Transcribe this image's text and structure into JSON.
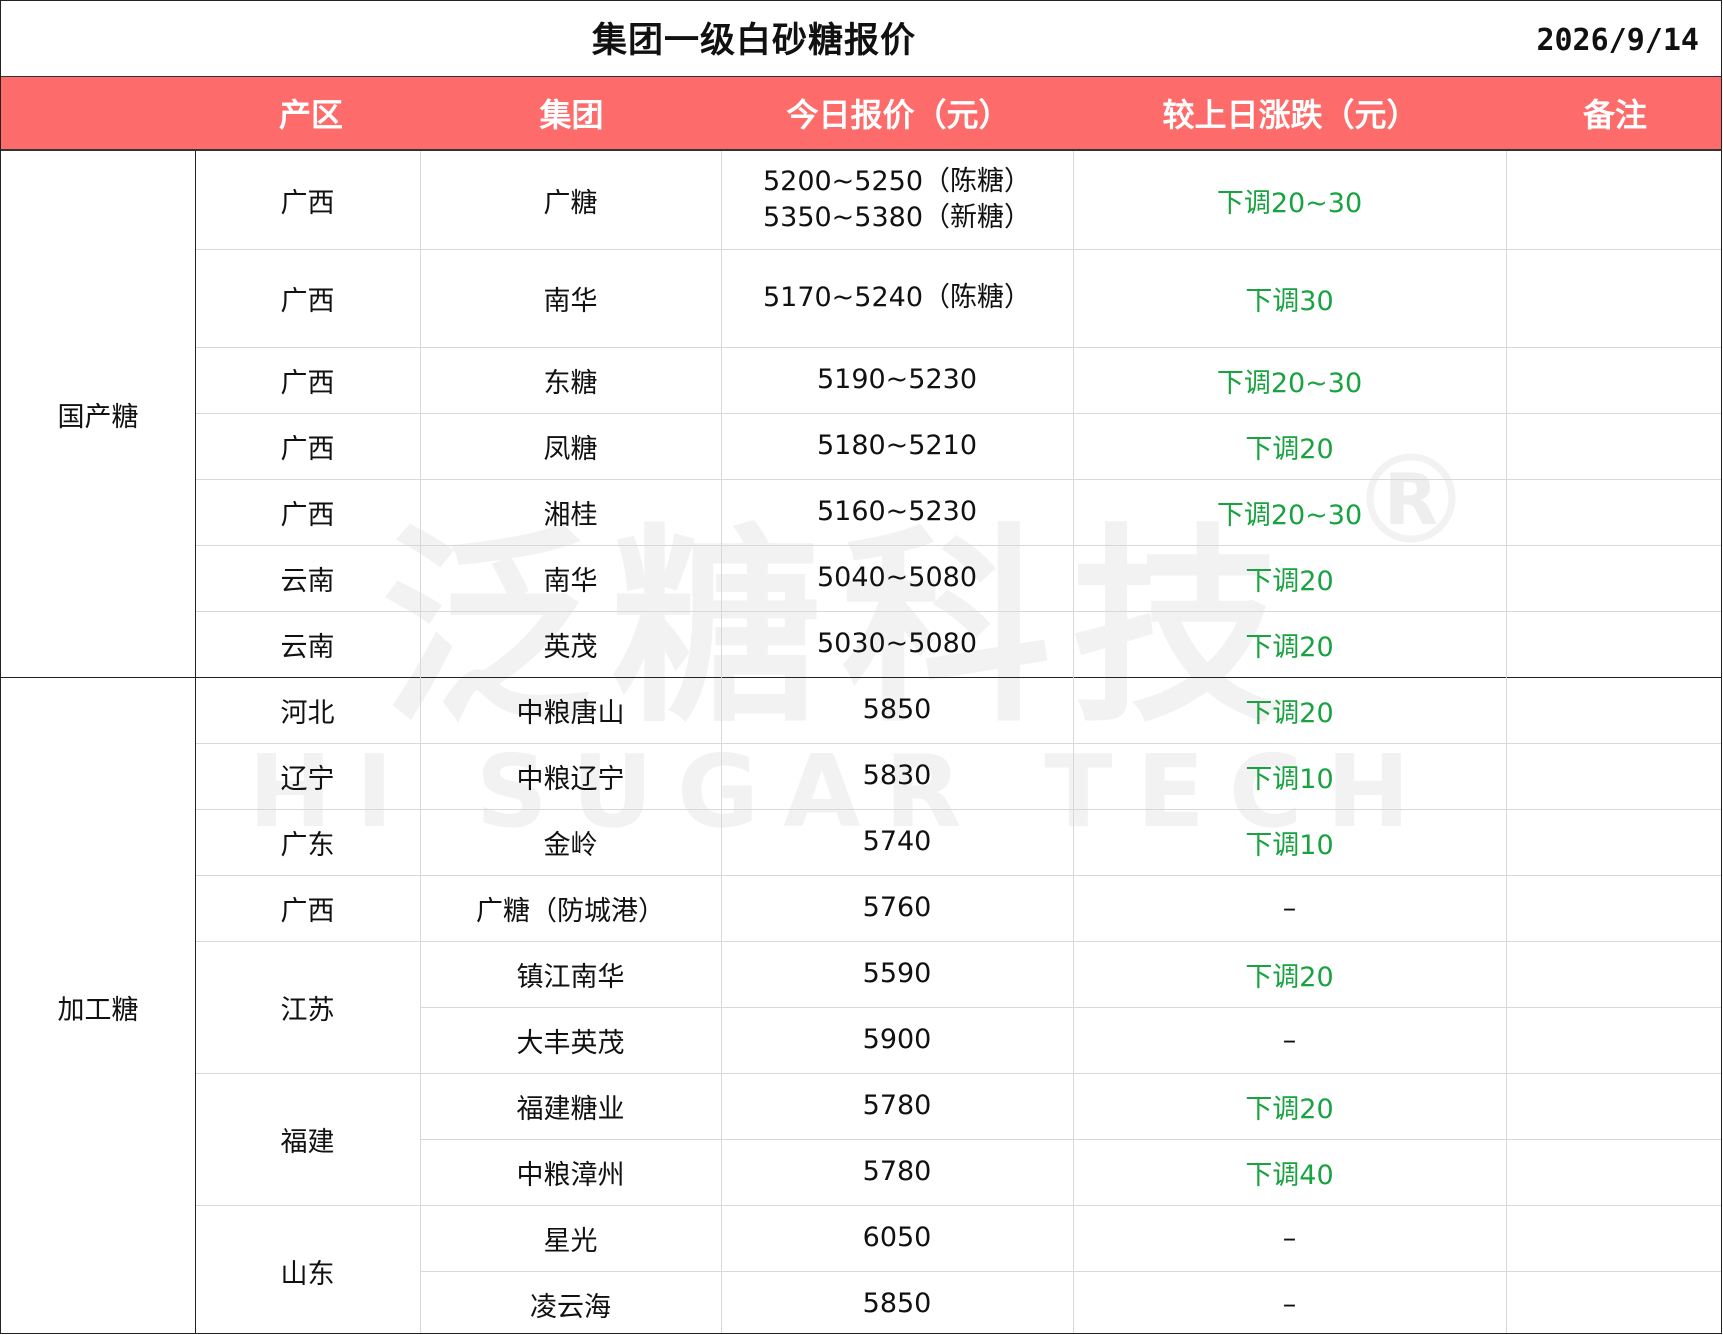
{
  "title": "集团一级白砂糖报价",
  "date": "2026/9/14",
  "colors": {
    "header_bg": "#fd6b6b",
    "header_text": "#ffffff",
    "change_text": "#18a340",
    "watermark": "#f2f2f2"
  },
  "watermark": {
    "cn": "泛糖科技",
    "en": "HI SUGAR TECH",
    "mark": "®"
  },
  "headers": [
    "产区",
    "集团",
    "今日报价（元）",
    "较上日涨跌（元）",
    "备注"
  ],
  "categories": [
    {
      "name": "国产糖"
    },
    {
      "name": "加工糖"
    }
  ],
  "region_groups": [
    "广西",
    "广西",
    "广西",
    "广西",
    "广西",
    "云南",
    "云南",
    "河北",
    "辽宁",
    "广东",
    "广西",
    "江苏",
    "福建",
    "山东"
  ],
  "rows": [
    {
      "group": "广糖",
      "price": [
        "5200~5250（陈糖）",
        "5350~5380（新糖）"
      ],
      "change": "下调20~30",
      "note": ""
    },
    {
      "group": "南华",
      "price": [
        "5170~5240（陈糖）"
      ],
      "change": "下调30",
      "note": ""
    },
    {
      "group": "东糖",
      "price": [
        "5190~5230"
      ],
      "change": "下调20~30",
      "note": ""
    },
    {
      "group": "凤糖",
      "price": [
        "5180~5210"
      ],
      "change": "下调20",
      "note": ""
    },
    {
      "group": "湘桂",
      "price": [
        "5160~5230"
      ],
      "change": "下调20~30",
      "note": ""
    },
    {
      "group": "南华",
      "price": [
        "5040~5080"
      ],
      "change": "下调20",
      "note": ""
    },
    {
      "group": "英茂",
      "price": [
        "5030~5080"
      ],
      "change": "下调20",
      "note": ""
    },
    {
      "group": "中粮唐山",
      "price": [
        "5850"
      ],
      "change": "下调20",
      "note": ""
    },
    {
      "group": "中粮辽宁",
      "price": [
        "5830"
      ],
      "change": "下调10",
      "note": ""
    },
    {
      "group": "金岭",
      "price": [
        "5740"
      ],
      "change": "下调10",
      "note": ""
    },
    {
      "group": "广糖（防城港）",
      "price": [
        "5760"
      ],
      "change": "–",
      "note": ""
    },
    {
      "group": "镇江南华",
      "price": [
        "5590"
      ],
      "change": "下调20",
      "note": ""
    },
    {
      "group": "大丰英茂",
      "price": [
        "5900"
      ],
      "change": "–",
      "note": ""
    },
    {
      "group": "福建糖业",
      "price": [
        "5780"
      ],
      "change": "下调20",
      "note": ""
    },
    {
      "group": "中粮漳州",
      "price": [
        "5780"
      ],
      "change": "下调40",
      "note": ""
    },
    {
      "group": "星光",
      "price": [
        "6050"
      ],
      "change": "–",
      "note": ""
    },
    {
      "group": "凌云海",
      "price": [
        "5850"
      ],
      "change": "–",
      "note": ""
    }
  ]
}
